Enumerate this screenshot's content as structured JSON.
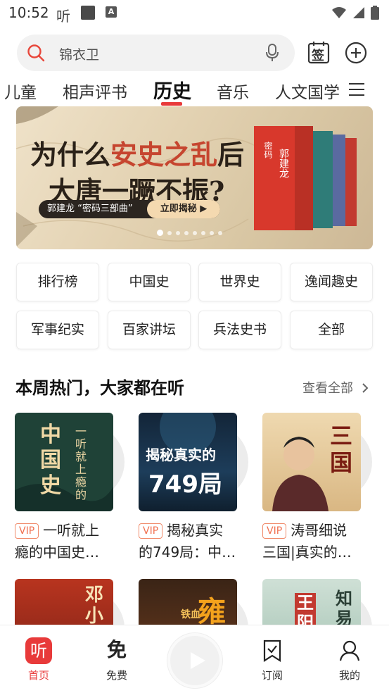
{
  "status_bar": {
    "time": "10:52",
    "app_icon_char": "听",
    "a_icon": "A"
  },
  "search": {
    "placeholder": "锦衣卫",
    "icon": "search-icon",
    "mic_icon": "microphone-icon"
  },
  "header_buttons": {
    "signin_label": "签"
  },
  "tabs": [
    {
      "label": "儿童"
    },
    {
      "label": "相声评书"
    },
    {
      "label": "历史",
      "active": true
    },
    {
      "label": "音乐"
    },
    {
      "label": "人文国学"
    }
  ],
  "banner": {
    "title_1_pre": "为什么",
    "title_1_hl": "安史之乱",
    "title_1_post": "后",
    "title_2": "大唐一蹶不振?",
    "pill_text": "郭建龙 “密码三部曲”",
    "pill_cta": "立即揭秘 ▶",
    "dot_count": 8,
    "active_dot": 0
  },
  "categories": [
    {
      "label": "排行榜"
    },
    {
      "label": "中国史"
    },
    {
      "label": "世界史"
    },
    {
      "label": "逸闻趣史"
    },
    {
      "label": "军事纪实"
    },
    {
      "label": "百家讲坛"
    },
    {
      "label": "兵法史书"
    },
    {
      "label": "全部"
    }
  ],
  "section": {
    "title": "本周热门，大家都在听",
    "see_all": "查看全部"
  },
  "albums": [
    {
      "vip": "VIP",
      "line1": "一听就上",
      "line2": "瘾的中国史…",
      "cover_text": "中国史",
      "cover_side": "一听就上瘾的"
    },
    {
      "vip": "VIP",
      "line1": "揭秘真实",
      "line2": "的749局：中…",
      "cover_text": "揭秘真实的",
      "cover_big": "749局"
    },
    {
      "vip": "VIP",
      "line1": "涛哥细说",
      "line2": "三国|真实的…",
      "cover_text": "三国"
    }
  ],
  "albums_row2": [
    {
      "cover_text": "邓小"
    },
    {
      "cover_text": "雍",
      "cover_side": "铁血"
    },
    {
      "cover_text": "王阳",
      "cover_side": "知易"
    }
  ],
  "bottom_nav": [
    {
      "label": "首页",
      "active": true,
      "icon": "home-ting-icon"
    },
    {
      "label": "免费",
      "icon": "free-icon"
    },
    {
      "label": "订阅",
      "icon": "subscribe-icon"
    },
    {
      "label": "我的",
      "icon": "profile-icon"
    }
  ],
  "colors": {
    "accent": "#e83a3a",
    "vip": "#f07050"
  }
}
